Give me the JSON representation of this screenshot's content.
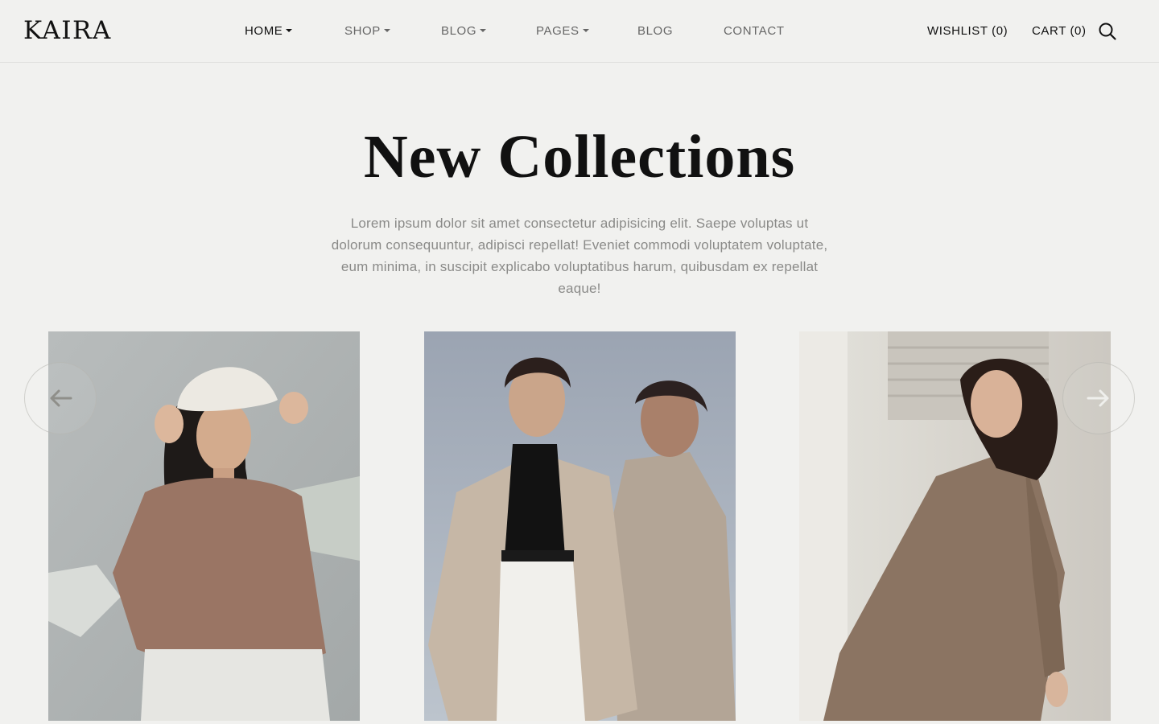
{
  "header": {
    "logo": "KAIRA",
    "nav": [
      {
        "label": "HOME",
        "dropdown": true,
        "active": true
      },
      {
        "label": "SHOP",
        "dropdown": true,
        "active": false
      },
      {
        "label": "BLOG",
        "dropdown": true,
        "active": false
      },
      {
        "label": "PAGES",
        "dropdown": true,
        "active": false
      },
      {
        "label": "BLOG",
        "dropdown": false,
        "active": false
      },
      {
        "label": "CONTACT",
        "dropdown": false,
        "active": false
      }
    ],
    "wishlist": "WISHLIST (0)",
    "cart": "CART (0)",
    "search_icon": "search-icon"
  },
  "hero": {
    "title": "New Collections",
    "description": "Lorem ipsum dolor sit amet consectetur adipisicing elit. Saepe voluptas ut dolorum consequuntur, adipisci repellat! Eveniet commodi voluptatem voluptate, eum minima, in suscipit explicabo voluptatibus harum, quibusdam ex repellat eaque!"
  },
  "carousel": {
    "prev_icon": "arrow-left-icon",
    "next_icon": "arrow-right-icon"
  },
  "colors": {
    "background": "#f1f1ef",
    "text": "#111111",
    "muted_text": "#8a8a88",
    "nav_text": "#666666"
  }
}
